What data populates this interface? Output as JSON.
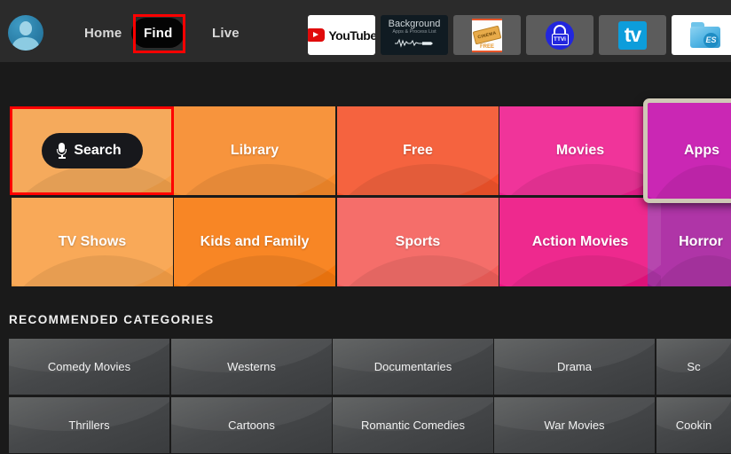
{
  "header": {
    "avatar": "profile-avatar",
    "nav": [
      {
        "label": "Home",
        "active": false
      },
      {
        "label": "Find",
        "active": true
      },
      {
        "label": "Live",
        "active": false
      }
    ],
    "apps": [
      {
        "name": "youtube",
        "label": "YouTube"
      },
      {
        "name": "background-apps",
        "label": "Background",
        "sublabel": "Apps & Process List"
      },
      {
        "name": "cinema-free",
        "label": "CINEMA",
        "sublabel": "FREE"
      },
      {
        "name": "ttvi",
        "label": "TTVi"
      },
      {
        "name": "tv",
        "label": "tv"
      },
      {
        "name": "es-file-explorer",
        "label": "ES"
      }
    ]
  },
  "search": {
    "label": "Search",
    "icon": "microphone-icon"
  },
  "tiles": [
    {
      "label": "Search",
      "color": "#f4a24c",
      "focused": false,
      "is_search": true
    },
    {
      "label": "Library",
      "color": "#f78a2a",
      "focused": false
    },
    {
      "label": "Free",
      "color": "#f5542c",
      "focused": false
    },
    {
      "label": "Movies",
      "color": "#ef2090",
      "focused": false
    },
    {
      "label": "Apps",
      "color": "#c512ad",
      "focused": true
    },
    {
      "label": "TV Shows",
      "color": "#f9a148",
      "focused": false
    },
    {
      "label": "Kids and Family",
      "color": "#f87a10",
      "focused": false
    },
    {
      "label": "Sports",
      "color": "#f4605c",
      "focused": false
    },
    {
      "label": "Action Movies",
      "color": "#ed1483",
      "focused": false
    },
    {
      "label": "Horror",
      "color": "#a8219f",
      "focused": false
    }
  ],
  "recommended": {
    "title": "RECOMMENDED CATEGORIES",
    "items": [
      "Comedy Movies",
      "Westerns",
      "Documentaries",
      "Drama",
      "Sc",
      "Thrillers",
      "Cartoons",
      "Romantic Comedies",
      "War Movies",
      "Cookin"
    ]
  },
  "annotations": {
    "find_highlight": "red-box-find-tab",
    "search_highlight": "red-box-search-tile",
    "color": "#fe0000"
  }
}
